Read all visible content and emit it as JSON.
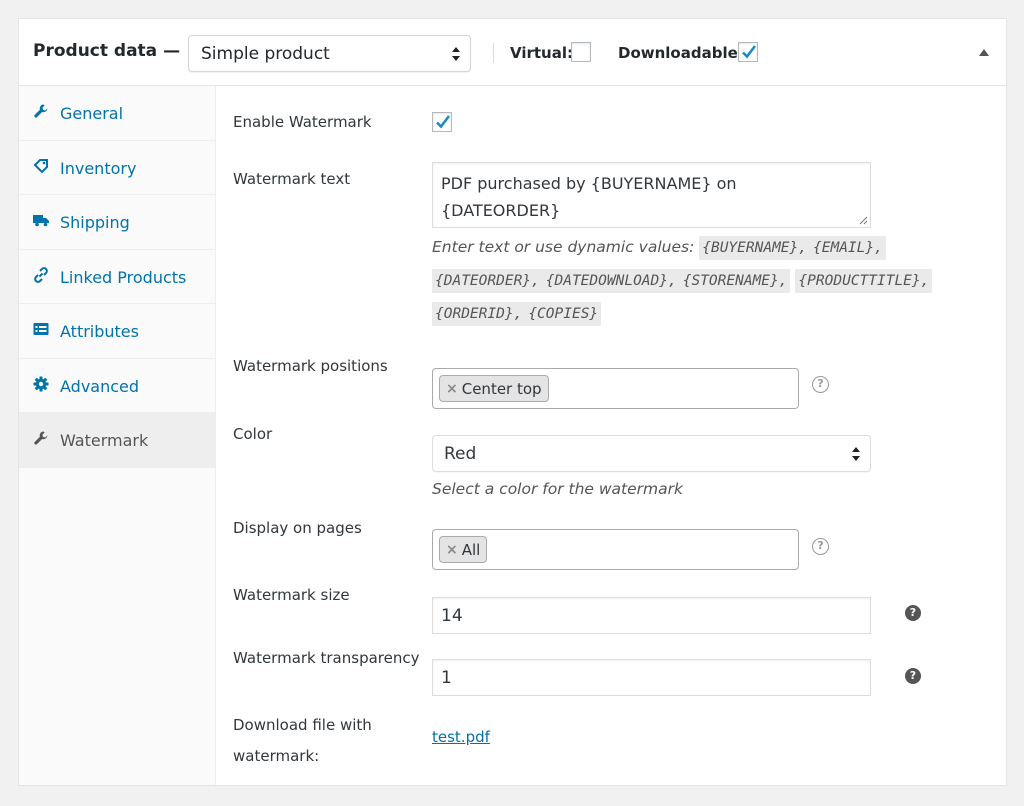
{
  "header": {
    "title": "Product data —",
    "product_type": "Simple product",
    "virtual_label": "Virtual:",
    "virtual_checked": false,
    "downloadable_label": "Downloadable:",
    "downloadable_checked": true
  },
  "sidebar": {
    "items": [
      {
        "label": "General",
        "icon": "wrench-icon",
        "active": false
      },
      {
        "label": "Inventory",
        "icon": "tag-icon",
        "active": false
      },
      {
        "label": "Shipping",
        "icon": "truck-icon",
        "active": false
      },
      {
        "label": "Linked Products",
        "icon": "link-icon",
        "active": false
      },
      {
        "label": "Attributes",
        "icon": "list-icon",
        "active": false
      },
      {
        "label": "Advanced",
        "icon": "gear-icon",
        "active": false
      },
      {
        "label": "Watermark",
        "icon": "wrench-icon",
        "active": true
      }
    ]
  },
  "form": {
    "enable_label": "Enable Watermark",
    "enable_checked": true,
    "text_label": "Watermark text",
    "text_value_line1": "PDF purchased by {BUYERNAME} on",
    "text_value_line2": "{DATEORDER}",
    "text_desc": "Enter text or use dynamic values:",
    "dynamic_values": [
      "{BUYERNAME},",
      "{EMAIL},",
      "{DATEORDER},",
      "{DATEDOWNLOAD},",
      "{STORENAME},",
      "{PRODUCTTITLE},",
      "{ORDERID},",
      "{COPIES}"
    ],
    "positions_label": "Watermark positions",
    "positions_chip": "Center top",
    "color_label": "Color",
    "color_value": "Red",
    "color_desc": "Select a color for the watermark",
    "pages_label": "Display on pages",
    "pages_chip": "All",
    "size_label": "Watermark size",
    "size_value": "14",
    "transparency_label": "Watermark transparency",
    "transparency_value": "1",
    "download_label_line1": "Download file with",
    "download_label_line2": "watermark:",
    "download_link": "test.pdf"
  },
  "colors": {
    "link": "#0073aa",
    "check": "#1e8cbe"
  }
}
